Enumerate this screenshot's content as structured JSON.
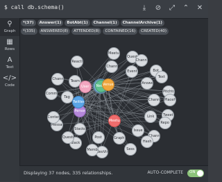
{
  "query": "$ call db.schema()",
  "toolbar_icons": [
    "download-icon",
    "pin-icon",
    "expand-icon",
    "collapse-icon",
    "close-icon"
  ],
  "sidebar": {
    "items": [
      {
        "label": "Graph",
        "icon": "graph-icon"
      },
      {
        "label": "Rows",
        "icon": "table-icon"
      },
      {
        "label": "Text",
        "icon": "text-icon"
      },
      {
        "label": "Code",
        "icon": "code-icon"
      }
    ]
  },
  "labels_row": [
    "*(37)",
    "Answer(1)",
    "BotAbt(1)",
    "Channel(1)",
    "ChannelArchive(1)"
  ],
  "rels_row": [
    "*(335)",
    "ANSWERED(8)",
    "ATTENDED(8)",
    "CONTAINED(16)",
    "CREATED(40)"
  ],
  "nodes": [
    {
      "label": "Link"
    },
    {
      "label": "Tweet"
    },
    {
      "label": "Repo"
    },
    {
      "label": "Issue"
    },
    {
      "label": "Chann"
    },
    {
      "label": "Hash"
    },
    {
      "label": "Graph"
    },
    {
      "label": "Sess"
    },
    {
      "label": "Meetup",
      "color": "red"
    },
    {
      "label": "Post"
    },
    {
      "label": "NeoVin"
    },
    {
      "label": "Member"
    },
    {
      "label": "Stackov"
    },
    {
      "label": "Slack"
    },
    {
      "label": "Question"
    },
    {
      "label": "Person",
      "color": "purple"
    },
    {
      "label": "Message"
    },
    {
      "label": "Content"
    },
    {
      "label": "Tag"
    },
    {
      "label": "Twitter",
      "color": "blue"
    },
    {
      "label": "Commit"
    },
    {
      "label": "Team"
    },
    {
      "label": "Channe"
    },
    {
      "label": "User",
      "color": "pink"
    },
    {
      "label": "GitHub",
      "color": "steel"
    },
    {
      "label": "Reactio"
    },
    {
      "label": "Neo4j",
      "color": "green"
    },
    {
      "label": "Channel"
    },
    {
      "label": "Venue",
      "color": "orange"
    },
    {
      "label": "Meetup"
    },
    {
      "label": "Event"
    },
    {
      "label": "Questio"
    },
    {
      "label": "Channel"
    },
    {
      "label": "Answer"
    },
    {
      "label": "Bot"
    },
    {
      "label": "Text"
    },
    {
      "label": "Channe"
    },
    {
      "label": "Pitchtone"
    },
    {
      "label": "PlaceH"
    }
  ],
  "status": "Displaying 37 nodes, 335 relationships.",
  "autocomplete": {
    "label": "AUTO-COMPLETE",
    "state": "ON"
  }
}
